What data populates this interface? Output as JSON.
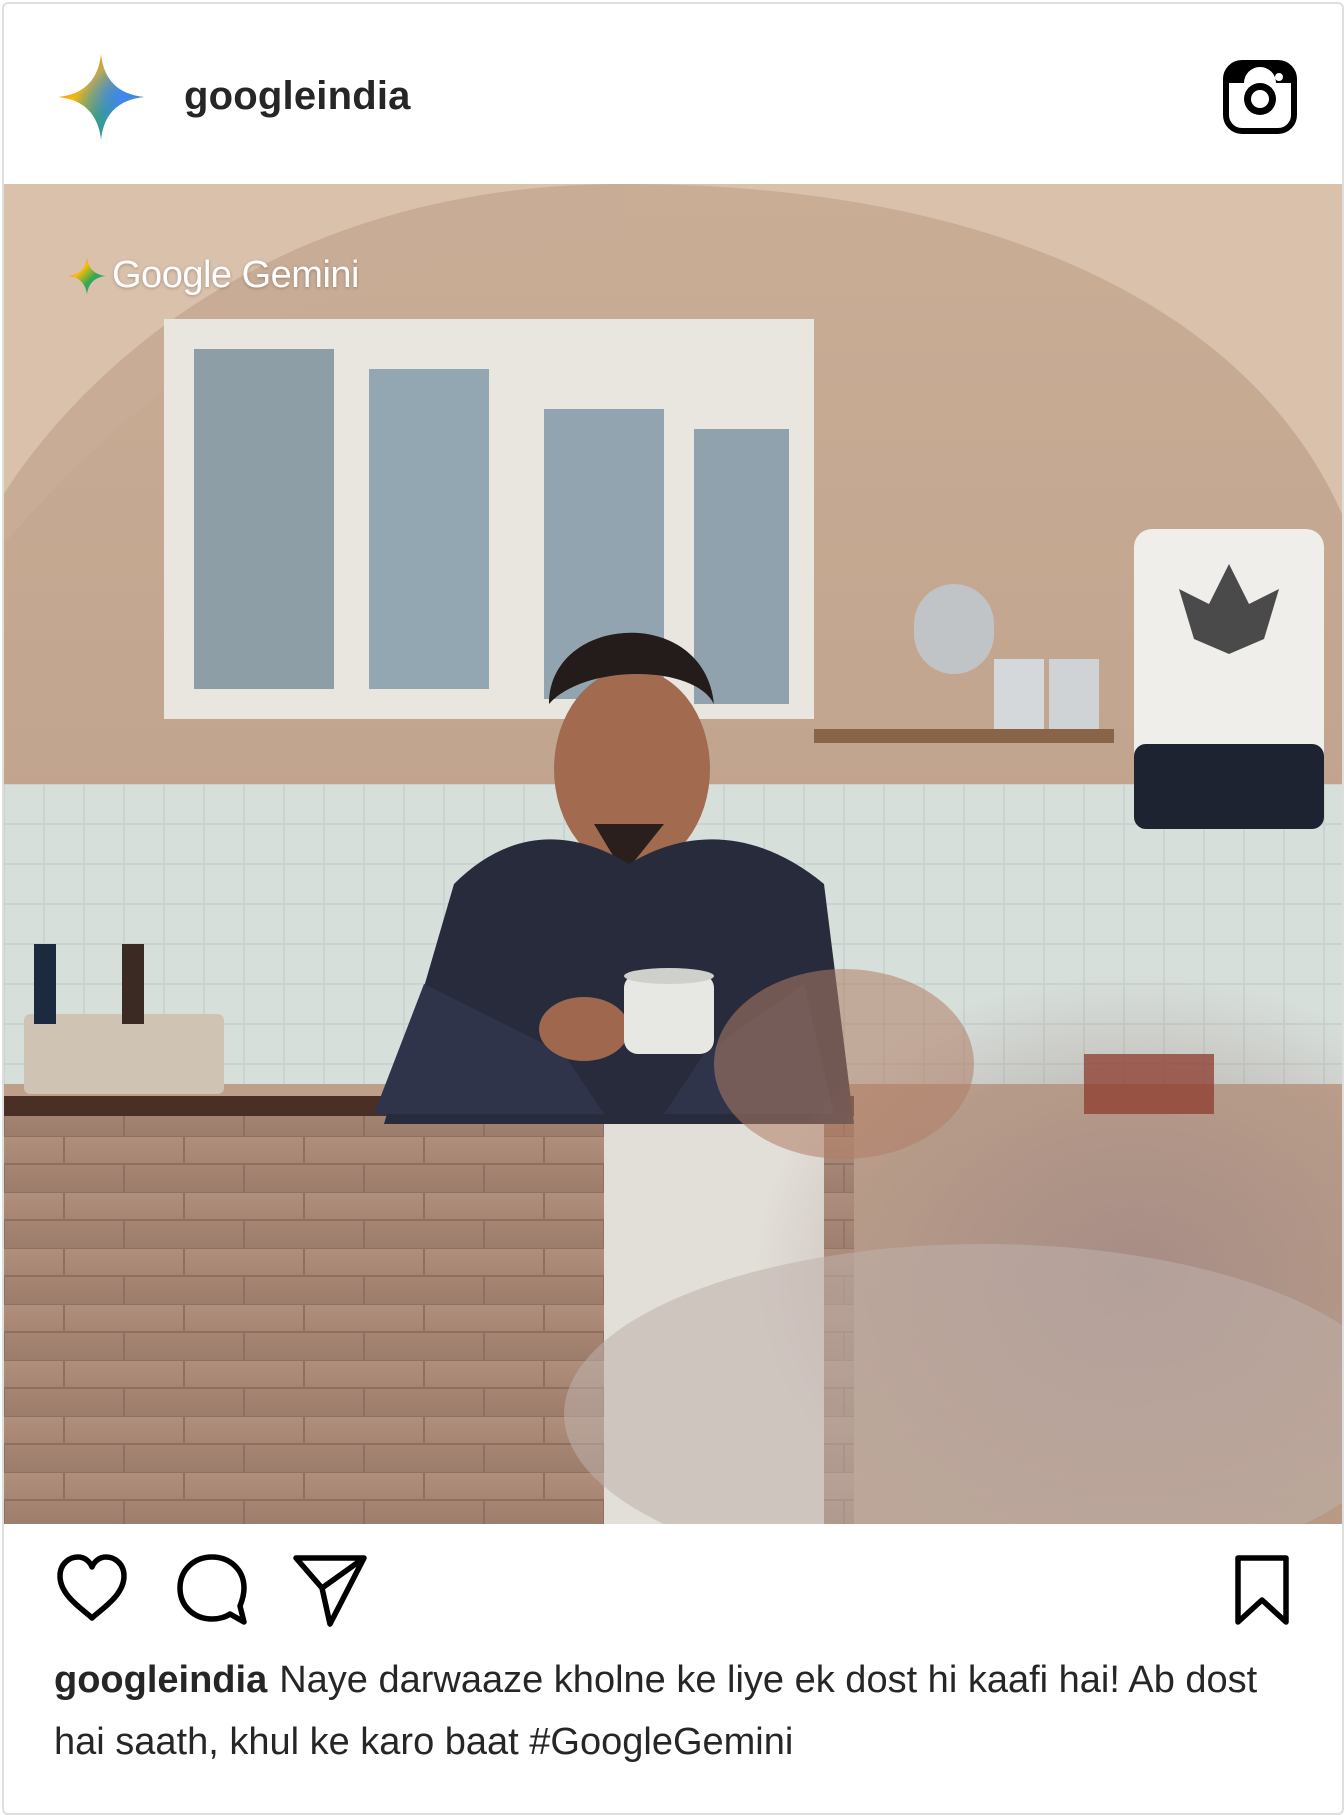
{
  "post": {
    "username": "googleindia",
    "watermark": "Google Gemini",
    "caption_user": "googleindia",
    "caption_text": "Naye darwaaze kholne ke liye ek dost hi kaafi hai! Ab dost hai saath, khul ke karo baat #GoogleGemini"
  },
  "icons": {
    "profile": "gemini-sparkle-icon",
    "platform": "instagram-icon",
    "like": "heart-icon",
    "comment": "comment-bubble-icon",
    "share": "paper-plane-icon",
    "save": "bookmark-icon"
  },
  "colors": {
    "text": "#262626",
    "border": "#dedede",
    "gemini_blue": "#4285F4",
    "gemini_red": "#EA4335",
    "gemini_yellow": "#FBBC05",
    "gemini_green": "#34A853"
  }
}
